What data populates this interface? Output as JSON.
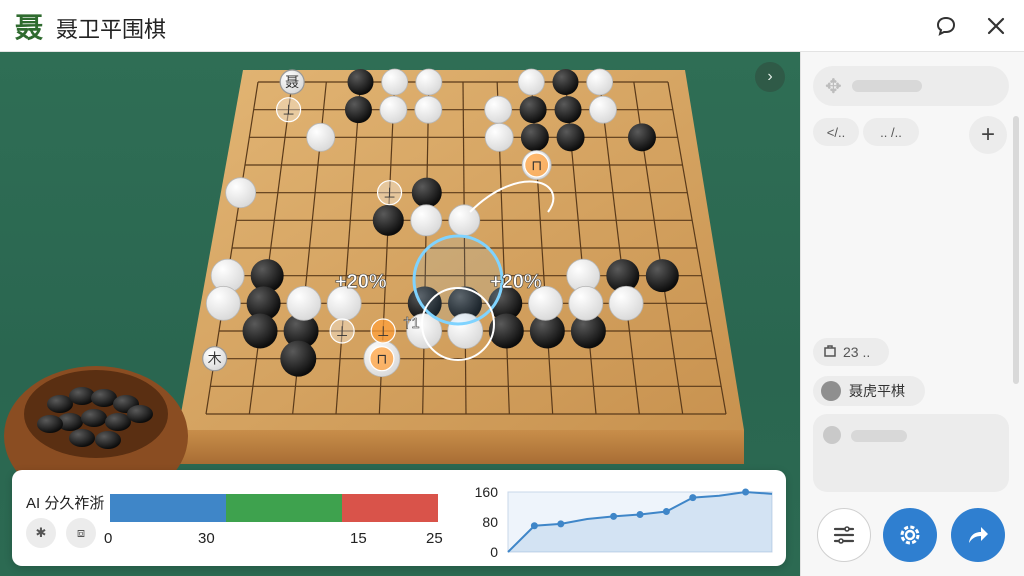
{
  "app": {
    "logo_glyph": "聂",
    "title": "聂卫平围棋"
  },
  "topbar": {
    "chat_icon": "chat-bubble-icon",
    "close_icon": "close-icon"
  },
  "board": {
    "size": 13,
    "stones": {
      "black": [
        [
          3,
          0
        ],
        [
          3,
          1
        ],
        [
          9,
          0
        ],
        [
          8,
          1
        ],
        [
          9,
          1
        ],
        [
          10,
          1
        ],
        [
          8,
          2
        ],
        [
          9,
          2
        ],
        [
          11,
          2
        ],
        [
          5,
          4
        ],
        [
          4,
          5
        ],
        [
          1,
          7
        ],
        [
          10,
          7
        ],
        [
          11,
          7
        ],
        [
          1,
          8
        ],
        [
          5,
          8
        ],
        [
          6,
          8
        ],
        [
          7,
          8
        ],
        [
          1,
          9
        ],
        [
          2,
          9
        ],
        [
          7,
          9
        ],
        [
          8,
          9
        ],
        [
          9,
          9
        ],
        [
          2,
          10
        ]
      ],
      "white": [
        [
          4,
          0
        ],
        [
          5,
          0
        ],
        [
          8,
          0
        ],
        [
          10,
          0
        ],
        [
          4,
          1
        ],
        [
          5,
          1
        ],
        [
          7,
          1
        ],
        [
          10,
          1
        ],
        [
          2,
          2
        ],
        [
          7,
          2
        ],
        [
          8,
          3
        ],
        [
          0,
          4
        ],
        [
          5,
          5
        ],
        [
          6,
          5
        ],
        [
          0,
          7
        ],
        [
          9,
          7
        ],
        [
          0,
          8
        ],
        [
          2,
          8
        ],
        [
          3,
          8
        ],
        [
          8,
          8
        ],
        [
          9,
          8
        ],
        [
          10,
          8
        ],
        [
          5,
          9
        ],
        [
          6,
          9
        ],
        [
          4,
          10
        ]
      ]
    },
    "markers": [
      {
        "label": "聂",
        "kind": "white-label"
      },
      {
        "label": "⊥",
        "kind": "ghost"
      },
      {
        "label": "⊥",
        "kind": "ghost"
      },
      {
        "label": "⊥",
        "kind": "ghost"
      },
      {
        "label": "木",
        "kind": "white-label"
      },
      {
        "label": "⊓",
        "kind": "orange-ghost"
      },
      {
        "label": "⊥",
        "kind": "orange-ghost"
      },
      {
        "label": "⊓",
        "kind": "orange-ghost"
      }
    ],
    "annotations": {
      "left_pct": "+20%",
      "right_pct": "+20%",
      "center_mark": "†1"
    },
    "collapse_icon": "chevron-right-icon"
  },
  "analysis": {
    "title": "AI 分久祚浙",
    "buttons": [
      {
        "icon": "asterisk-icon",
        "glyph": "✱"
      },
      {
        "icon": "device-icon",
        "glyph": "⧈"
      }
    ],
    "bar": {
      "segments": [
        {
          "color": "#3f86c8",
          "value": 30
        },
        {
          "color": "#3ea24e",
          "value": 15
        },
        {
          "color": "#3ea24e",
          "value": 15
        },
        {
          "color": "#d9534a",
          "value": 25
        }
      ],
      "tick_labels": [
        "0",
        "30",
        "15",
        "25"
      ]
    },
    "chart_data": {
      "type": "line",
      "yticks": [
        "160",
        "80",
        "0"
      ],
      "ylim": [
        0,
        160
      ],
      "x": [
        0,
        1,
        2,
        3,
        4,
        5,
        6,
        7,
        8,
        9,
        10
      ],
      "values": [
        0,
        70,
        75,
        88,
        95,
        100,
        108,
        145,
        150,
        160,
        155
      ],
      "markers_at": [
        1,
        2,
        4,
        5,
        6,
        7,
        9
      ],
      "color": "#3f86c8"
    }
  },
  "sidebar": {
    "header_icon": "puzzle-icon",
    "chips": [
      "</..",
      ".. /.."
    ],
    "add_icon": "plus-icon",
    "add_glyph": "+",
    "move_count": "23 ..",
    "move_icon": "bag-icon",
    "player_name": "聂虎平棋",
    "actions": [
      {
        "icon": "menu-lines-icon"
      },
      {
        "icon": "gear-icon"
      },
      {
        "icon": "share-arrow-icon"
      }
    ],
    "accent": "#2f7fd0"
  }
}
